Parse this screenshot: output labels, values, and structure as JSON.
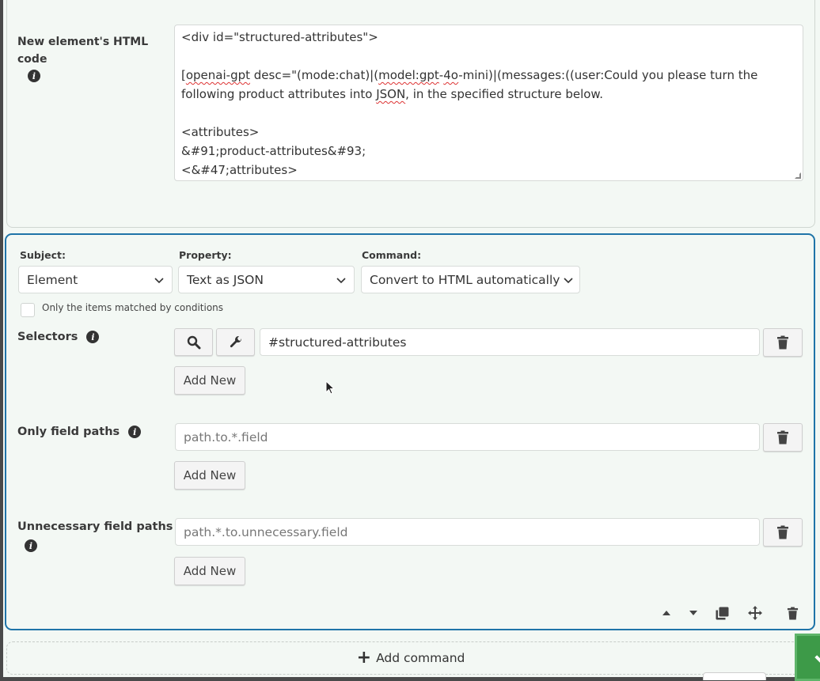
{
  "html_code_field": {
    "label": "New element's HTML code",
    "value_lines": {
      "l1": "<div id=\"structured-attributes\">",
      "l2": "",
      "l3a": "openai-gpt",
      "l3b": " desc=\"(mode:chat)|(",
      "l3c": "model:gpt",
      "l3d": "-",
      "l3e": "4o",
      "l3f": "-mini)|(messages:((user:Could you please turn the",
      "l4a": "following product attributes into ",
      "l4b": "JSON",
      "l4c": ", in the specified structure below.",
      "l5": "",
      "l6": "<attributes>",
      "l7": "&#91;product-attributes&#93;",
      "l8": "<&#47;attributes>"
    }
  },
  "command_panel": {
    "subject": {
      "label": "Subject:",
      "value": "Element"
    },
    "property": {
      "label": "Property:",
      "value": "Text as JSON"
    },
    "command": {
      "label": "Command:",
      "value": "Convert to HTML automatically"
    },
    "only_matched_checkbox": {
      "label": "Only the items matched by conditions",
      "checked": false
    },
    "selectors": {
      "label": "Selectors",
      "value": "#structured-attributes",
      "add_label": "Add New"
    },
    "only_field_paths": {
      "label": "Only field paths",
      "placeholder": "path.to.*.field",
      "add_label": "Add New"
    },
    "unnecessary_field_paths": {
      "label": "Unnecessary field paths",
      "placeholder": "path.*.to.unnecessary.field",
      "add_label": "Add New"
    },
    "toolbar": [
      "move-up",
      "move-down",
      "duplicate",
      "drag",
      "delete"
    ]
  },
  "add_command": {
    "label": "Add command"
  },
  "colors": {
    "accent_border": "#1f74a8",
    "panel_bg": "#f3f8f4",
    "save_green": "#3d9a48"
  }
}
